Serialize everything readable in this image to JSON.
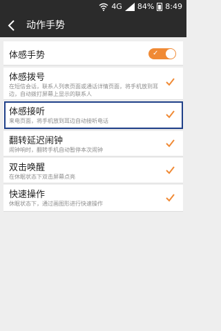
{
  "status_bar": {
    "network": "4G",
    "battery": "84%",
    "time": "8:49"
  },
  "toolbar": {
    "title": "动作手势"
  },
  "settings": [
    {
      "title": "体感手势",
      "type": "toggle",
      "enabled": true
    },
    {
      "title": "体感拨号",
      "subtitle": "在短信会话，联系人列表页面或通话详情页面，将手机放到耳边，自动拨打屏幕上显示的联系人",
      "type": "check",
      "checked": true
    },
    {
      "title": "体感接听",
      "subtitle": "来电页面，将手机放到耳边自动接听电话",
      "type": "check",
      "checked": true
    },
    {
      "title": "翻转延迟闹钟",
      "subtitle": "闹钟响时，翻转手机自动暂停本次闹钟",
      "type": "check",
      "checked": true
    },
    {
      "title": "双击唤醒",
      "subtitle": "在休眠状态下双击屏幕点亮",
      "type": "check",
      "checked": true
    },
    {
      "title": "快速操作",
      "subtitle": "休眠状态下，通过画图形进行快速操作",
      "type": "check",
      "checked": true
    }
  ],
  "colors": {
    "accent": "#f08a35",
    "highlight": "#1e3f88"
  }
}
